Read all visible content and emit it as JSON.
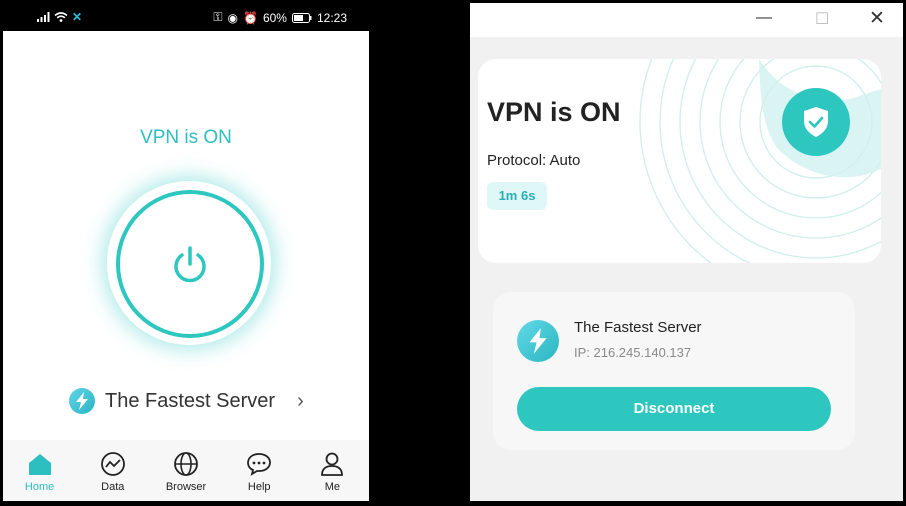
{
  "phone": {
    "status_bar": {
      "battery": "60%",
      "time": "12:23"
    },
    "title": "VPN is ON",
    "server": {
      "name": "The Fastest Server"
    },
    "nav": [
      {
        "label": "Home",
        "icon": "home-icon",
        "active": true
      },
      {
        "label": "Data",
        "icon": "data-chart-icon",
        "active": false
      },
      {
        "label": "Browser",
        "icon": "globe-icon",
        "active": false
      },
      {
        "label": "Help",
        "icon": "chat-bubble-icon",
        "active": false
      },
      {
        "label": "Me",
        "icon": "user-icon",
        "active": false
      }
    ]
  },
  "desktop": {
    "status": {
      "title": "VPN is ON",
      "protocol": "Protocol: Auto",
      "elapsed": "1m 6s"
    },
    "server": {
      "name": "The Fastest Server",
      "ip": "IP: 216.245.140.137"
    },
    "disconnect_label": "Disconnect"
  },
  "colors": {
    "accent": "#2ec7c0",
    "accent_text": "#2dbfbf",
    "timer_bg": "#e0f7f7"
  }
}
